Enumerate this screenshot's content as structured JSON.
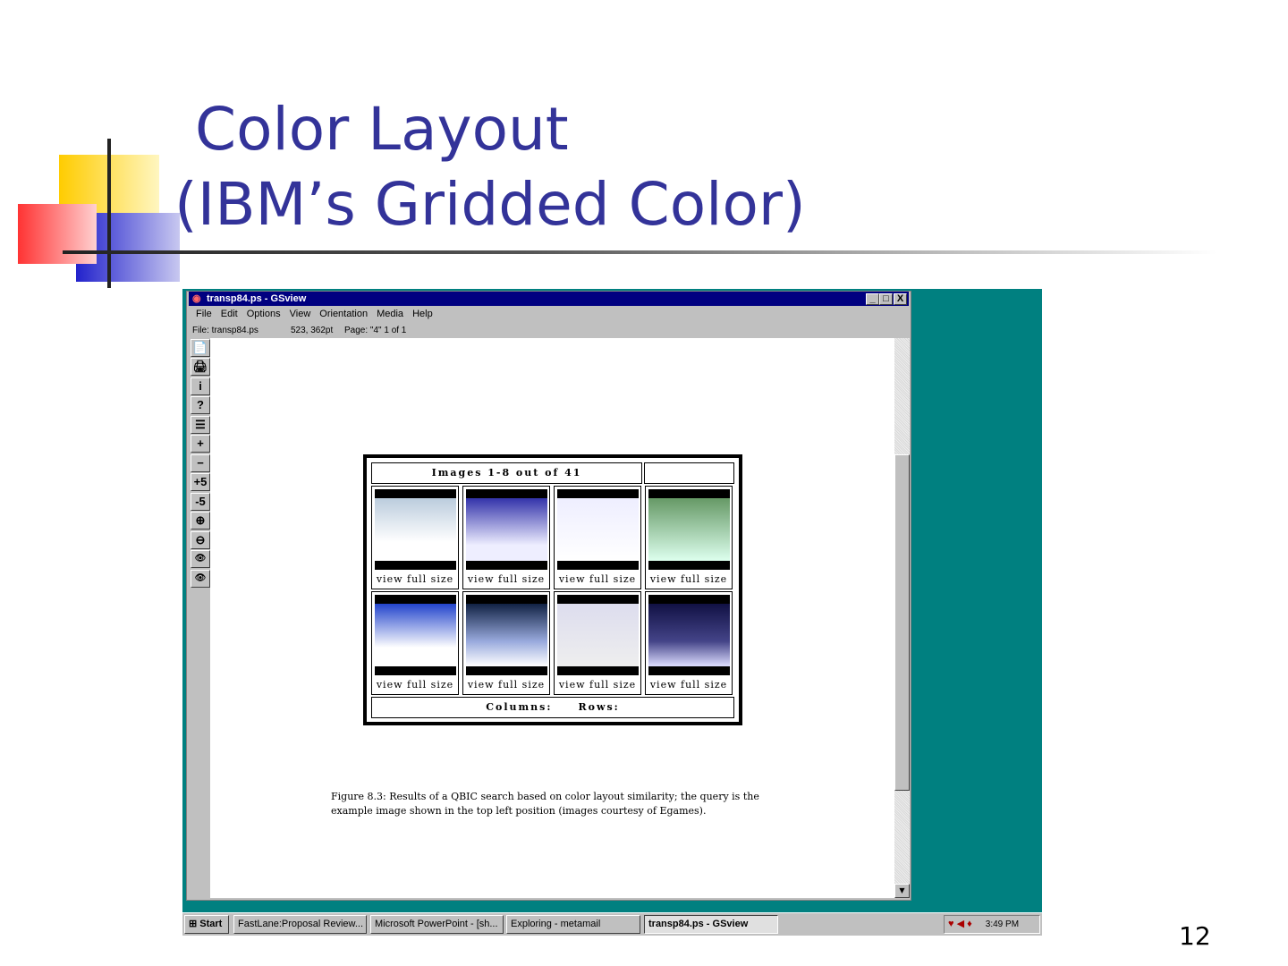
{
  "slide": {
    "title_line1": "Color Layout",
    "title_line2": "(IBM’s Gridded Color)",
    "page_number": "12",
    "title_color": "#333399"
  },
  "window": {
    "title": "transp84.ps - GSview",
    "controls": [
      "_",
      "□",
      "X"
    ],
    "menu": [
      "File",
      "Edit",
      "Options",
      "View",
      "Orientation",
      "Media",
      "Help"
    ],
    "status": {
      "file": "File: transp84.ps",
      "coords": "523, 362pt",
      "page": "Page: \"4\"  1 of 1"
    },
    "toolbar": [
      "📄",
      "🖨",
      "i",
      "?",
      "☰",
      "+",
      "−",
      "+5",
      "-5",
      "⊕",
      "⊖",
      "👁",
      "👁"
    ]
  },
  "document": {
    "table_header": "Images 1-8 out of 41",
    "cell_caption": "view full size",
    "footer": "Columns:     Rows:",
    "figure_caption_1": "Figure 8.3: Results of a QBIC search based on color layout similarity; the query is the",
    "figure_caption_2": "example image shown in the top left position (images courtesy of Egames)."
  },
  "taskbar": {
    "start": "Start",
    "items": [
      "FastLane:Proposal Review...",
      "Microsoft PowerPoint - [sh...",
      "Exploring - metamail",
      "transp84.ps - GSview"
    ],
    "clock": "3:49 PM"
  }
}
